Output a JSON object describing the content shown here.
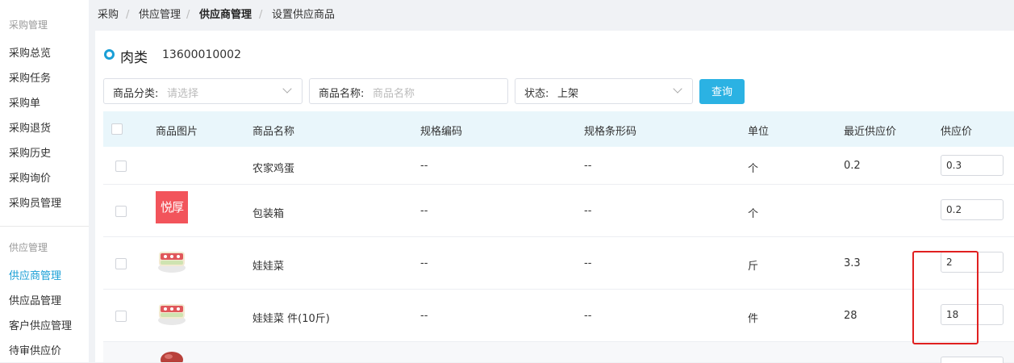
{
  "sidebar": {
    "group1_title": "采购管理",
    "group1_items": [
      "采购总览",
      "采购任务",
      "采购单",
      "采购退货",
      "采购历史",
      "采购询价",
      "采购员管理"
    ],
    "group2_title": "供应管理",
    "group2_items": [
      "供应商管理",
      "供应品管理",
      "客户供应管理",
      "待审供应价"
    ],
    "active_item": "供应商管理"
  },
  "breadcrumb": {
    "items": [
      "采购",
      "供应管理",
      "供应商管理",
      "设置供应商品"
    ],
    "separator": "/"
  },
  "header": {
    "supplier_name": "肉类",
    "supplier_phone": "13600010002"
  },
  "filters": {
    "category_label": "商品分类:",
    "category_placeholder": "请选择",
    "name_label": "商品名称:",
    "name_placeholder": "商品名称",
    "status_label": "状态:",
    "status_value": "上架",
    "query_button": "查询"
  },
  "table": {
    "columns": [
      "商品图片",
      "商品名称",
      "规格编码",
      "规格条形码",
      "单位",
      "最近供应价",
      "供应价"
    ],
    "rows": [
      {
        "image": "",
        "name": "农家鸡蛋",
        "spec_code": "--",
        "barcode": "--",
        "unit": "个",
        "recent_price": "0.2",
        "price": "0.3"
      },
      {
        "image": "悦厚",
        "name": "包装箱",
        "spec_code": "--",
        "barcode": "--",
        "unit": "个",
        "recent_price": "",
        "price": "0.2"
      },
      {
        "image": "cabbage-photo",
        "name": "娃娃菜",
        "spec_code": "--",
        "barcode": "--",
        "unit": "斤",
        "recent_price": "3.3",
        "price": "2"
      },
      {
        "image": "cabbage-photo",
        "name": "娃娃菜 件(10斤)",
        "spec_code": "--",
        "barcode": "--",
        "unit": "件",
        "recent_price": "28",
        "price": "18"
      }
    ]
  },
  "colors": {
    "accent": "#1a9fd6",
    "button": "#2bb2e3",
    "table_header": "#e9f6fb",
    "highlight_box": "#e02020"
  }
}
